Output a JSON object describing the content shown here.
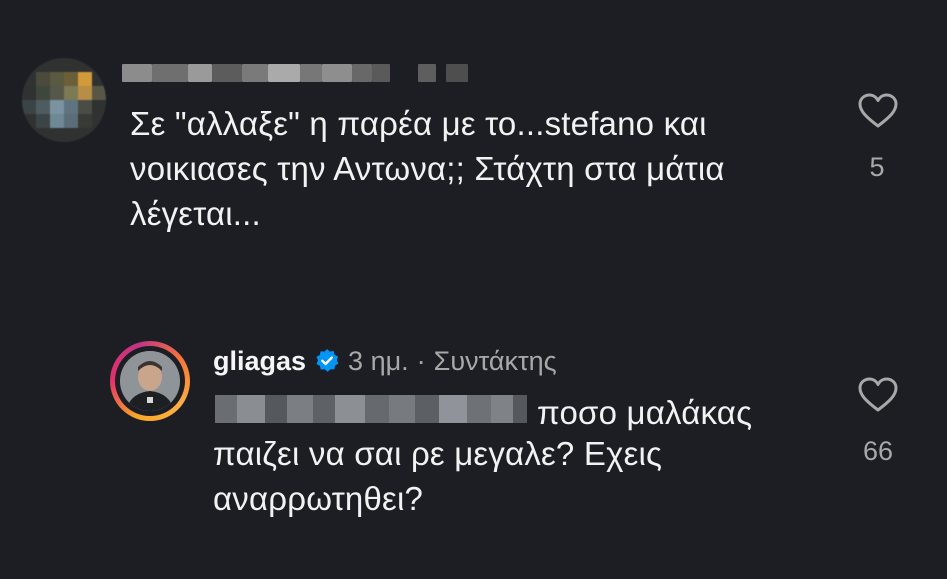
{
  "comment_1": {
    "text": "Σε \"αλλαξε\" η παρέα με το...stefano και\nνοικιασες την Αντωνα;; Στάχτη στα μάτια\nλέγεται...",
    "likes": "5",
    "like_icon": "heart-outline-icon"
  },
  "comment_2": {
    "username": "gliagas",
    "verified_icon": "verified-badge-icon",
    "time": "3 ημ.",
    "separator": "·",
    "role": "Συντάκτης",
    "text_line1": "ποσο μαλάκας",
    "text_rest": "παιζει να σαι ρε μεγαλε? Εχεις\nαναρρωτηθει?",
    "likes": "66",
    "like_icon": "heart-outline-icon"
  },
  "colors": {
    "background": "#1c1e24",
    "text_primary": "#f2f2f2",
    "text_secondary": "#a8a8a8",
    "verified_blue": "#0095f6"
  }
}
